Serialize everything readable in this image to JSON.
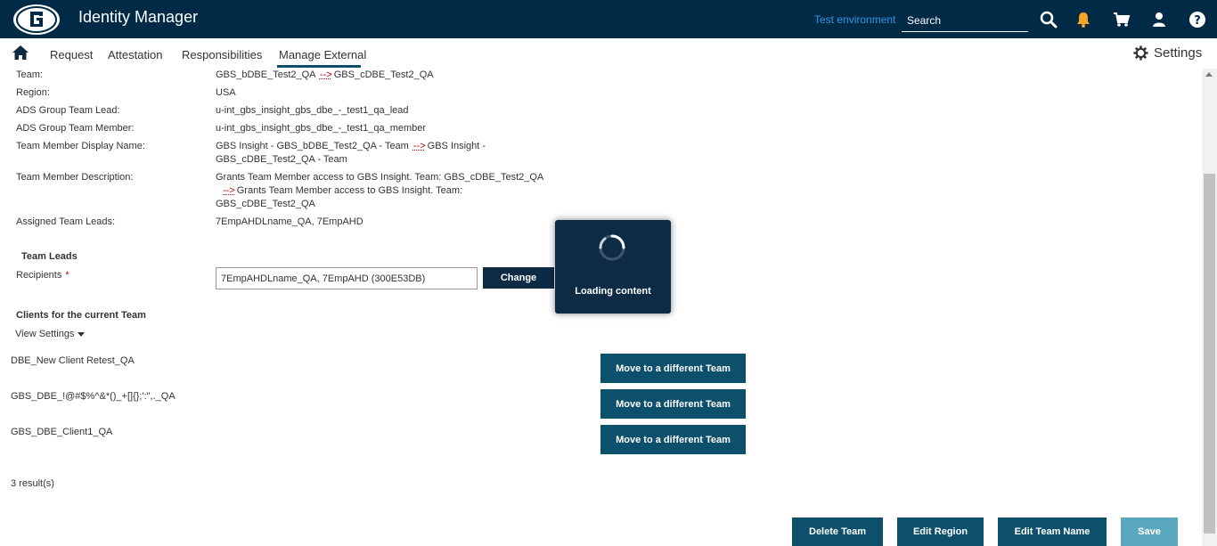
{
  "header": {
    "app_title": "Identity Manager",
    "environment": "Test environment",
    "search_placeholder": "Search"
  },
  "nav": {
    "items": [
      "Request",
      "Attestation",
      "Responsibilities",
      "Manage External"
    ],
    "active": "Manage External",
    "settings_label": "Settings"
  },
  "details": [
    {
      "label": "Team:",
      "old": "GBS_bDBE_Test2_QA",
      "arrow": "-->",
      "new": "GBS_cDBE_Test2_QA"
    },
    {
      "label": "Region:",
      "value": "USA"
    },
    {
      "label": "ADS Group Team Lead:",
      "value": "u-int_gbs_insight_gbs_dbe_-_test1_qa_lead"
    },
    {
      "label": "ADS Group Team Member:",
      "value": "u-int_gbs_insight_gbs_dbe_-_test1_qa_member"
    },
    {
      "label": "Team Member Display Name:",
      "old": "GBS Insight - GBS_bDBE_Test2_QA - Team",
      "arrow": "-->",
      "new": "GBS Insight - GBS_cDBE_Test2_QA - Team"
    },
    {
      "label": "Team Member Description:",
      "old": "Grants Team Member access to GBS Insight. Team: GBS_cDBE_Test2_QA",
      "arrow": "-->",
      "new": "Grants Team Member access to GBS Insight. Team: GBS_cDBE_Test2_QA"
    },
    {
      "label": "Assigned Team Leads:",
      "value": "7EmpAHDLname_QA, 7EmpAHD"
    }
  ],
  "team_leads": {
    "heading": "Team Leads",
    "recipients_label": "Recipients",
    "required_mark": "*",
    "recipients_value": "7EmpAHDLname_QA, 7EmpAHD (300E53DB)",
    "change_label": "Change"
  },
  "clients": {
    "heading": "Clients for the current Team",
    "view_settings": "View Settings",
    "items": [
      "DBE_New Client Retest_QA",
      "GBS_DBE_!@#$%^&*()_+[]{};':\",._QA",
      "GBS_DBE_Client1_QA"
    ],
    "move_label": "Move to a different Team",
    "result_count": "3 result(s)"
  },
  "actions": {
    "delete": "Delete Team",
    "edit_region": "Edit Region",
    "edit_name": "Edit Team Name",
    "save": "Save"
  },
  "loading": {
    "text": "Loading content"
  },
  "colors": {
    "header_bg": "#002a46",
    "accent_teal": "#0c506b",
    "save_disabled": "#5aa7c0",
    "env_link": "#2f96e6"
  }
}
